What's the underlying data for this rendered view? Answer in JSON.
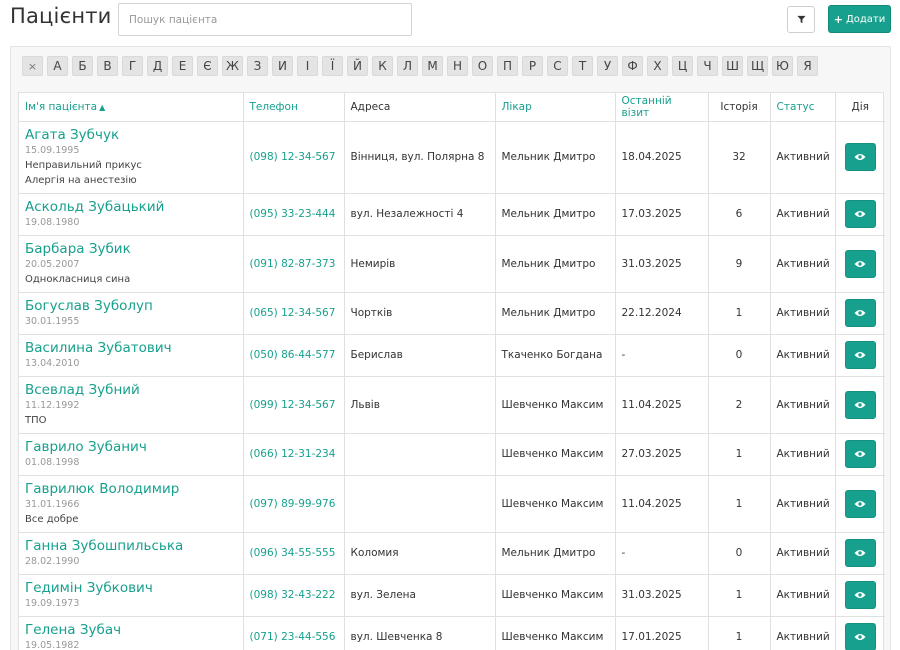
{
  "header": {
    "title": "Пацієнти",
    "search_placeholder": "Пошук пацієнта",
    "filter_icon": "filter-icon",
    "add_label": "Додати",
    "add_icon": "+"
  },
  "colors": {
    "accent": "#17a08d",
    "muted": "#999999"
  },
  "alphabet": {
    "clear": "×",
    "letters": [
      "А",
      "Б",
      "В",
      "Г",
      "Д",
      "Е",
      "Є",
      "Ж",
      "З",
      "И",
      "І",
      "Ї",
      "Й",
      "К",
      "Л",
      "М",
      "Н",
      "О",
      "П",
      "Р",
      "С",
      "Т",
      "У",
      "Ф",
      "Х",
      "Ц",
      "Ч",
      "Ш",
      "Щ",
      "Ю",
      "Я"
    ]
  },
  "table": {
    "columns": {
      "name": "Ім'я пацієнта",
      "phone": "Телефон",
      "address": "Адреса",
      "doctor": "Лікар",
      "last_visit": "Останній візит",
      "history": "Історія",
      "status": "Статус",
      "action": "Дія"
    },
    "rows": [
      {
        "name": "Агата Зубчук",
        "dob": "15.09.1995",
        "notes": [
          "Неправильний прикус",
          "Алергія на анестезію"
        ],
        "phone": "(098) 12-34-567",
        "address": "Вінниця, вул. Полярна 8",
        "doctor": "Мельник Дмитро",
        "last_visit": "18.04.2025",
        "history": "32",
        "status": "Активний"
      },
      {
        "name": "Аскольд Зубацький",
        "dob": "19.08.1980",
        "notes": [],
        "phone": "(095) 33-23-444",
        "address": "вул. Незалежності 4",
        "doctor": "Мельник Дмитро",
        "last_visit": "17.03.2025",
        "history": "6",
        "status": "Активний"
      },
      {
        "name": "Барбара Зубик",
        "dob": "20.05.2007",
        "notes": [
          "Однокласниця сина"
        ],
        "phone": "(091) 82-87-373",
        "address": "Немирів",
        "doctor": "Мельник Дмитро",
        "last_visit": "31.03.2025",
        "history": "9",
        "status": "Активний"
      },
      {
        "name": "Богуслав Зуболуп",
        "dob": "30.01.1955",
        "notes": [],
        "phone": "(065) 12-34-567",
        "address": "Чортків",
        "doctor": "Мельник Дмитро",
        "last_visit": "22.12.2024",
        "history": "1",
        "status": "Активний"
      },
      {
        "name": "Василина Зубатович",
        "dob": "13.04.2010",
        "notes": [],
        "phone": "(050) 86-44-577",
        "address": "Берислав",
        "doctor": "Ткаченко Богдана",
        "last_visit": "-",
        "history": "0",
        "status": "Активний"
      },
      {
        "name": "Всевлад Зубний",
        "dob": "11.12.1992",
        "notes": [
          "ТПО"
        ],
        "phone": "(099) 12-34-567",
        "address": "Львів",
        "doctor": "Шевченко Максим",
        "last_visit": "11.04.2025",
        "history": "2",
        "status": "Активний"
      },
      {
        "name": "Гаврило Зубанич",
        "dob": "01.08.1998",
        "notes": [],
        "phone": "(066) 12-31-234",
        "address": "",
        "doctor": "Шевченко Максим",
        "last_visit": "27.03.2025",
        "history": "1",
        "status": "Активний"
      },
      {
        "name": "Гаврилюк Володимир",
        "dob": "31.01.1966",
        "notes": [
          "Все добре"
        ],
        "phone": "(097) 89-99-976",
        "address": "",
        "doctor": "Шевченко Максим",
        "last_visit": "11.04.2025",
        "history": "1",
        "status": "Активний"
      },
      {
        "name": "Ганна Зубошпильська",
        "dob": "28.02.1990",
        "notes": [],
        "phone": "(096) 34-55-555",
        "address": "Коломия",
        "doctor": "Мельник Дмитро",
        "last_visit": "-",
        "history": "0",
        "status": "Активний"
      },
      {
        "name": "Гедимін Зубкович",
        "dob": "19.09.1973",
        "notes": [],
        "phone": "(098) 32-43-222",
        "address": "вул. Зелена",
        "doctor": "Шевченко Максим",
        "last_visit": "31.03.2025",
        "history": "1",
        "status": "Активний"
      },
      {
        "name": "Гелена Зубач",
        "dob": "19.05.1982",
        "notes": [],
        "phone": "(071) 23-44-556",
        "address": "вул. Шевченка 8",
        "doctor": "Шевченко Максим",
        "last_visit": "17.01.2025",
        "history": "1",
        "status": "Активний"
      }
    ]
  }
}
